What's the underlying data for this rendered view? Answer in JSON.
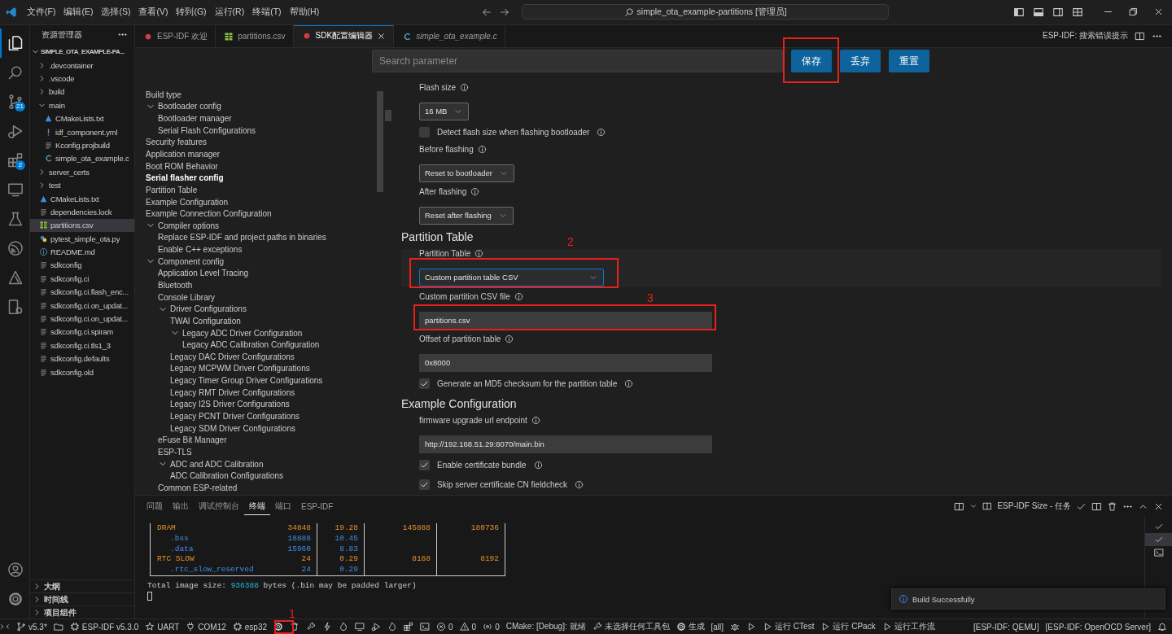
{
  "title_bar": {
    "menus": [
      "文件(F)",
      "编辑(E)",
      "选择(S)",
      "查看(V)",
      "转到(G)",
      "运行(R)",
      "终端(T)",
      "帮助(H)"
    ],
    "command_center": "simple_ota_example-partitions [管理员]"
  },
  "activity_bar": {
    "items": [
      {
        "selected": true
      },
      {
        "selected": false
      },
      {
        "selected": false,
        "badge": "21"
      },
      {
        "selected": false
      },
      {
        "selected": false,
        "badge": "2"
      },
      {
        "selected": false
      },
      {
        "selected": false
      },
      {
        "selected": false
      },
      {
        "selected": false
      },
      {
        "selected": false
      }
    ]
  },
  "explorer": {
    "title": "资源管理器",
    "root": {
      "label": "SIMPLE_OTA_EXAMPLE-PA...",
      "expanded": true
    },
    "items": [
      {
        "kind": "folder",
        "label": ".devcontainer",
        "expanded": false,
        "selected": false
      },
      {
        "kind": "folder",
        "label": ".vscode",
        "expanded": false,
        "selected": false
      },
      {
        "kind": "folder",
        "label": "build",
        "expanded": false,
        "selected": false
      },
      {
        "kind": "folder",
        "label": "main",
        "expanded": true,
        "selected": false,
        "children": [
          {
            "kind": "cmake",
            "label": "CMakeLists.txt",
            "selected": false
          },
          {
            "kind": "yaml",
            "label": "idf_component.yml",
            "selected": false
          },
          {
            "kind": "text",
            "label": "Kconfig.projbuild",
            "selected": false
          },
          {
            "kind": "c",
            "label": "simple_ota_example.c",
            "selected": false
          }
        ]
      },
      {
        "kind": "folder",
        "label": "server_certs",
        "expanded": false,
        "selected": false
      },
      {
        "kind": "folder",
        "label": "test",
        "expanded": false,
        "selected": false
      },
      {
        "kind": "cmake",
        "label": "CMakeLists.txt",
        "selected": false
      },
      {
        "kind": "text",
        "label": "dependencies.lock",
        "selected": false
      },
      {
        "kind": "csv",
        "label": "partitions.csv",
        "selected": true
      },
      {
        "kind": "python",
        "label": "pytest_simple_ota.py",
        "selected": false
      },
      {
        "kind": "info",
        "label": "README.md",
        "selected": false
      },
      {
        "kind": "text",
        "label": "sdkconfig",
        "selected": false
      },
      {
        "kind": "text",
        "label": "sdkconfig.ci",
        "selected": false
      },
      {
        "kind": "text",
        "label": "sdkconfig.ci.flash_enc...",
        "selected": false
      },
      {
        "kind": "text",
        "label": "sdkconfig.ci.on_updat...",
        "selected": false
      },
      {
        "kind": "text",
        "label": "sdkconfig.ci.on_updat...",
        "selected": false
      },
      {
        "kind": "text",
        "label": "sdkconfig.ci.spiram",
        "selected": false
      },
      {
        "kind": "text",
        "label": "sdkconfig.ci.tls1_3",
        "selected": false
      },
      {
        "kind": "text",
        "label": "sdkconfig.defaults",
        "selected": false
      },
      {
        "kind": "text",
        "label": "sdkconfig.old",
        "selected": false
      }
    ],
    "sections": [
      {
        "label": "大纲",
        "expanded": false
      },
      {
        "label": "时间线",
        "expanded": false
      },
      {
        "label": "项目组件",
        "expanded": false
      }
    ]
  },
  "editor_tabs": {
    "tabs": [
      {
        "kind": "esp",
        "label": "ESP-IDF 欢迎",
        "selected": false,
        "preview": false
      },
      {
        "kind": "csv",
        "label": "partitions.csv",
        "selected": false,
        "preview": false
      },
      {
        "kind": "esp",
        "label": "SDK配置编辑器",
        "selected": true,
        "preview": false
      },
      {
        "kind": "c",
        "label": "simple_ota_example.c",
        "selected": false,
        "preview": true
      }
    ],
    "actions_label": "ESP-IDF: 搜索错误提示"
  },
  "sdk_editor": {
    "search": {
      "placeholder": "Search parameter"
    },
    "buttons": [
      "保存",
      "丢弃",
      "重置"
    ],
    "menu": [
      {
        "label": "Build type",
        "selected": false
      },
      {
        "label": "Bootloader config",
        "selected": false,
        "expanded": true,
        "children": [
          {
            "label": "Bootloader manager",
            "selected": false
          },
          {
            "label": "Serial Flash Configurations",
            "selected": false
          }
        ]
      },
      {
        "label": "Security features",
        "selected": false
      },
      {
        "label": "Application manager",
        "selected": false
      },
      {
        "label": "Boot ROM Behavior",
        "selected": false
      },
      {
        "label": "Serial flasher config",
        "selected": true
      },
      {
        "label": "Partition Table",
        "selected": false
      },
      {
        "label": "Example Configuration",
        "selected": false
      },
      {
        "label": "Example Connection Configuration",
        "selected": false
      },
      {
        "label": "Compiler options",
        "selected": false,
        "expanded": true,
        "children": [
          {
            "label": "Replace ESP-IDF and project paths in binaries",
            "selected": false
          },
          {
            "label": "Enable C++ exceptions",
            "selected": false
          }
        ]
      },
      {
        "label": "Component config",
        "selected": false,
        "expanded": true,
        "children": [
          {
            "label": "Application Level Tracing",
            "selected": false
          },
          {
            "label": "Bluetooth",
            "selected": false
          },
          {
            "label": "Console Library",
            "selected": false
          },
          {
            "label": "Driver Configurations",
            "selected": false,
            "expanded": true,
            "children": [
              {
                "label": "TWAI Configuration",
                "selected": false
              },
              {
                "label": "Legacy ADC Driver Configuration",
                "selected": false,
                "expanded": true,
                "children": [
                  {
                    "label": "Legacy ADC Calibration Configuration",
                    "selected": false
                  }
                ]
              },
              {
                "label": "Legacy DAC Driver Configurations",
                "selected": false
              },
              {
                "label": "Legacy MCPWM Driver Configurations",
                "selected": false
              },
              {
                "label": "Legacy Timer Group Driver Configurations",
                "selected": false
              },
              {
                "label": "Legacy RMT Driver Configurations",
                "selected": false
              },
              {
                "label": "Legacy I2S Driver Configurations",
                "selected": false
              },
              {
                "label": "Legacy PCNT Driver Configurations",
                "selected": false
              },
              {
                "label": "Legacy SDM Driver Configurations",
                "selected": false
              }
            ]
          },
          {
            "label": "eFuse Bit Manager",
            "selected": false
          },
          {
            "label": "ESP-TLS",
            "selected": false
          },
          {
            "label": "ADC and ADC Calibration",
            "selected": false,
            "expanded": true,
            "children": [
              {
                "label": "ADC Calibration Configurations",
                "selected": false
              }
            ]
          },
          {
            "label": "Common ESP-related",
            "selected": false
          }
        ]
      }
    ],
    "sections": [
      {
        "items": [
          {
            "kind": "select",
            "label": "Flash size",
            "value": "16 MB",
            "focused": false
          },
          {
            "kind": "checkbox",
            "label": "Detect flash size when flashing bootloader",
            "checked": false
          },
          {
            "kind": "select",
            "label": "Before flashing",
            "value": "Reset to bootloader",
            "focused": false
          },
          {
            "kind": "select",
            "label": "After flashing",
            "value": "Reset after flashing",
            "focused": false
          }
        ]
      },
      {
        "title": "Partition Table",
        "items": [
          {
            "kind": "select",
            "label": "Partition Table",
            "value": "Custom partition table CSV",
            "focused": true
          },
          {
            "kind": "text",
            "label": "Custom partition CSV file",
            "value": "partitions.csv"
          },
          {
            "kind": "text",
            "label": "Offset of partition table",
            "value": "0x8000"
          },
          {
            "kind": "checkbox",
            "label": "Generate an MD5 checksum for the partition table",
            "checked": true
          }
        ]
      },
      {
        "title": "Example Configuration",
        "items": [
          {
            "kind": "text",
            "label": "firmware upgrade url endpoint",
            "value": "http://192.168.51.29:8070/main.bin"
          },
          {
            "kind": "checkbox",
            "label": "Enable certificate bundle",
            "checked": true
          },
          {
            "kind": "checkbox",
            "label": "Skip server certificate CN fieldcheck",
            "checked": true
          }
        ]
      }
    ]
  },
  "panel": {
    "tabs": [
      {
        "label": "问题",
        "selected": false
      },
      {
        "label": "输出",
        "selected": false
      },
      {
        "label": "调试控制台",
        "selected": false
      },
      {
        "label": "终端",
        "selected": true
      },
      {
        "label": "端口",
        "selected": false
      },
      {
        "label": "ESP-IDF",
        "selected": false
      }
    ],
    "task_label": "ESP-IDF Size - 任务",
    "terminal": {
      "rows": [
        {
          "kind": "region",
          "cells": [
            "DRAM",
            "34848",
            "19.28",
            "145888",
            "180736"
          ]
        },
        {
          "kind": "sub",
          "cells": [
            ".bss",
            "18888",
            "10.45"
          ]
        },
        {
          "kind": "sub",
          "cells": [
            ".data",
            "15960",
            "8.83"
          ]
        },
        {
          "kind": "region",
          "cells": [
            "RTC SLOW",
            "24",
            "0.29",
            "8168",
            "8192"
          ]
        },
        {
          "kind": "sub",
          "cells": [
            ".rtc_slow_reserved",
            "24",
            "0.29"
          ]
        }
      ],
      "total": {
        "prefix": "Total image size: ",
        "value": "936388",
        "suffix": " bytes (.bin may be padded larger)"
      }
    },
    "terminals": [
      {
        "kind": "task",
        "selected": false
      },
      {
        "kind": "task",
        "selected": true
      },
      {
        "kind": "shell",
        "selected": false
      }
    ]
  },
  "notification": {
    "message": "Build Successfully"
  },
  "status_bar": {
    "items": [
      "v5.3*",
      "ESP-IDF v5.3.0",
      "UART",
      "COM12",
      "esp32",
      "0",
      "0",
      "0",
      "CMake: [Debug]: 就绪",
      "未选择任何工具包",
      "生成",
      "[all]",
      "运行 CTest",
      "运行 CPack",
      "运行工作流",
      "[ESP-IDF: QEMU]",
      "[ESP-IDF: OpenOCD Server]"
    ]
  },
  "annotations": [
    {
      "kind": "box"
    },
    {
      "kind": "box",
      "label": "1"
    },
    {
      "kind": "box",
      "label": "2"
    },
    {
      "kind": "box",
      "label": "3"
    }
  ]
}
